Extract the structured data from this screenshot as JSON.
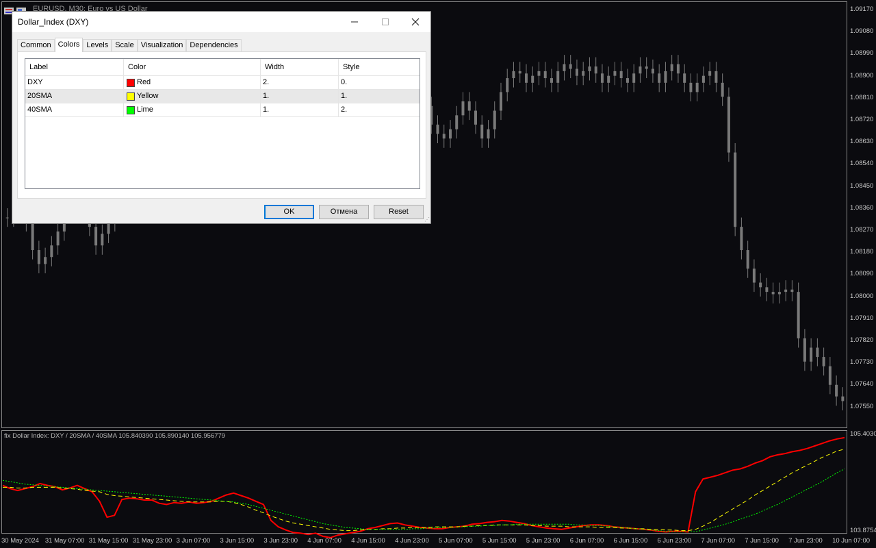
{
  "chart": {
    "title": "EURUSD, M30:  Euro vs US Dollar",
    "indicator_label": "fix Dollar Index: DXY / 20SMA / 40SMA 105.840390 105.890140 105.956779",
    "price_labels": [
      "1.09170",
      "1.09080",
      "1.08990",
      "1.08900",
      "1.08810",
      "1.08720",
      "1.08630",
      "1.08540",
      "1.08450",
      "1.08360",
      "1.08270",
      "1.08180",
      "1.08090",
      "1.08000",
      "1.07910",
      "1.07820",
      "1.07730",
      "1.07640",
      "1.07550"
    ],
    "sub_price_labels": [
      "105.4030",
      "103.8754"
    ],
    "time_labels": [
      "30 May 2024",
      "31 May 07:00",
      "31 May 15:00",
      "31 May 23:00",
      "3 Jun 07:00",
      "3 Jun 15:00",
      "3 Jun 23:00",
      "4 Jun 07:00",
      "4 Jun 15:00",
      "4 Jun 23:00",
      "5 Jun 07:00",
      "5 Jun 15:00",
      "5 Jun 23:00",
      "6 Jun 07:00",
      "6 Jun 15:00",
      "6 Jun 23:00",
      "7 Jun 07:00",
      "7 Jun 15:00",
      "7 Jun 23:00",
      "10 Jun 07:00"
    ],
    "colors": {
      "background": "#0b0b0f",
      "candles": "#7a7a7a",
      "dxy": "#ff0000",
      "sma20": "#ffff00",
      "sma40": "#00ff00"
    }
  },
  "dialog": {
    "title": "Dollar_Index (DXY)",
    "tabs": [
      "Common",
      "Colors",
      "Levels",
      "Scale",
      "Visualization",
      "Dependencies"
    ],
    "active_tab": "Colors",
    "columns": [
      "Label",
      "Color",
      "Width",
      "Style"
    ],
    "rows": [
      {
        "label": "DXY",
        "color_name": "Red",
        "color": "#ff0000",
        "width": "2.",
        "style": "0."
      },
      {
        "label": "20SMA",
        "color_name": "Yellow",
        "color": "#ffff00",
        "width": "1.",
        "style": "1."
      },
      {
        "label": "40SMA",
        "color_name": "Lime",
        "color": "#00ff00",
        "width": "1.",
        "style": "2."
      }
    ],
    "buttons": {
      "ok": "OK",
      "cancel": "Отмена",
      "reset": "Reset"
    },
    "icons": {
      "minimize": "minimize-icon",
      "maximize": "maximize-icon",
      "close": "close-icon"
    }
  },
  "chart_data": {
    "type": "line",
    "main_price_range": [
      1.07505,
      1.09215
    ],
    "indicator_range": [
      103.8754,
      105.403
    ],
    "series": [
      {
        "name": "DXY",
        "values": [
          104.6,
          104.55,
          104.52,
          104.55,
          104.58,
          104.63,
          104.6,
          104.58,
          104.53,
          104.56,
          104.6,
          104.55,
          104.5,
          104.35,
          104.1,
          104.13,
          104.38,
          104.4,
          104.39,
          104.37,
          104.37,
          104.32,
          104.3,
          104.33,
          104.32,
          104.34,
          104.32,
          104.33,
          104.35,
          104.4,
          104.45,
          104.48,
          104.44,
          104.4,
          104.35,
          104.3,
          104.05,
          103.95,
          103.9,
          103.86,
          103.85,
          103.83,
          103.85,
          103.8,
          103.78,
          103.82,
          103.84,
          103.86,
          103.88,
          103.92,
          103.94,
          103.97,
          104.0,
          104.01,
          103.98,
          103.96,
          103.94,
          103.93,
          103.92,
          103.92,
          103.94,
          103.95,
          103.96,
          103.99,
          104.0,
          104.02,
          104.03,
          104.05,
          104.04,
          104.02,
          104.0,
          103.97,
          103.95,
          103.93,
          103.92,
          103.91,
          103.93,
          103.95,
          103.97,
          103.98,
          103.98,
          103.97,
          103.95,
          103.94,
          103.93,
          103.92,
          103.91,
          103.9,
          103.88,
          103.87,
          103.88,
          103.88,
          103.87,
          104.5,
          104.7,
          104.73,
          104.76,
          104.8,
          104.84,
          104.86,
          104.9,
          104.95,
          104.99,
          105.05,
          105.08,
          105.1,
          105.13,
          105.15,
          105.18,
          105.22,
          105.26,
          105.3,
          105.33,
          105.35
        ]
      },
      {
        "name": "20SMA",
        "values": [
          104.57,
          104.57,
          104.56,
          104.56,
          104.57,
          104.57,
          104.57,
          104.57,
          104.56,
          104.55,
          104.54,
          104.52,
          104.51,
          104.5,
          104.46,
          104.44,
          104.43,
          104.42,
          104.41,
          104.4,
          104.39,
          104.38,
          104.37,
          104.36,
          104.35,
          104.34,
          104.34,
          104.34,
          104.34,
          104.35,
          104.35,
          104.33,
          104.3,
          104.26,
          104.21,
          104.17,
          104.12,
          104.08,
          104.04,
          104.01,
          103.99,
          103.97,
          103.95,
          103.93,
          103.91,
          103.9,
          103.89,
          103.89,
          103.9,
          103.91,
          103.91,
          103.92,
          103.92,
          103.93,
          103.93,
          103.94,
          103.94,
          103.94,
          103.95,
          103.95,
          103.95,
          103.95,
          103.96,
          103.96,
          103.97,
          103.97,
          103.98,
          103.98,
          103.98,
          103.98,
          103.98,
          103.97,
          103.97,
          103.96,
          103.96,
          103.96,
          103.95,
          103.95,
          103.95,
          103.95,
          103.94,
          103.94,
          103.94,
          103.93,
          103.93,
          103.92,
          103.92,
          103.91,
          103.91,
          103.9,
          103.9,
          103.89,
          103.89,
          103.91,
          103.96,
          104.02,
          104.09,
          104.16,
          104.23,
          104.3,
          104.37,
          104.45,
          104.52,
          104.59,
          104.66,
          104.73,
          104.8,
          104.86,
          104.92,
          104.98,
          105.04,
          105.09,
          105.14,
          105.17
        ]
      },
      {
        "name": "40SMA",
        "values": [
          104.68,
          104.66,
          104.64,
          104.62,
          104.61,
          104.6,
          104.59,
          104.58,
          104.57,
          104.56,
          104.55,
          104.54,
          104.53,
          104.52,
          104.51,
          104.5,
          104.49,
          104.48,
          104.47,
          104.46,
          104.45,
          104.44,
          104.43,
          104.42,
          104.41,
          104.4,
          104.39,
          104.38,
          104.37,
          104.36,
          104.35,
          104.34,
          104.32,
          104.3,
          104.27,
          104.24,
          104.21,
          104.18,
          104.15,
          104.12,
          104.09,
          104.06,
          104.03,
          104.0,
          103.98,
          103.96,
          103.94,
          103.93,
          103.92,
          103.91,
          103.91,
          103.91,
          103.91,
          103.91,
          103.91,
          103.92,
          103.92,
          103.93,
          103.93,
          103.94,
          103.94,
          103.95,
          103.95,
          103.96,
          103.96,
          103.97,
          103.97,
          103.98,
          103.98,
          103.99,
          103.99,
          103.99,
          103.99,
          103.99,
          103.99,
          103.99,
          103.99,
          103.98,
          103.98,
          103.97,
          103.97,
          103.96,
          103.95,
          103.94,
          103.93,
          103.92,
          103.91,
          103.9,
          103.89,
          103.88,
          103.87,
          103.87,
          103.87,
          103.87,
          103.9,
          103.93,
          103.96,
          103.99,
          104.03,
          104.07,
          104.11,
          104.15,
          104.2,
          104.25,
          104.3,
          104.36,
          104.42,
          104.48,
          104.54,
          104.6,
          104.66,
          104.73,
          104.8,
          104.86
        ]
      }
    ],
    "candles_close": [
      1.0832,
      1.0838,
      1.0835,
      1.083,
      1.0818,
      1.0812,
      1.0815,
      1.082,
      1.0826,
      1.0844,
      1.0852,
      1.0845,
      1.0835,
      1.0828,
      1.082,
      1.0825,
      1.083,
      1.0836,
      1.0842,
      1.085,
      1.0856,
      1.0864,
      1.087,
      1.0873,
      1.0868,
      1.0862,
      1.0858,
      1.086,
      1.0864,
      1.0868,
      1.0872,
      1.0876,
      1.088,
      1.0876,
      1.0874,
      1.087,
      1.0866,
      1.087,
      1.0876,
      1.088,
      1.0885,
      1.0888,
      1.0884,
      1.088,
      1.0876,
      1.0878,
      1.0882,
      1.088,
      1.0876,
      1.0872,
      1.0868,
      1.0866,
      1.0872,
      1.0878,
      1.0882,
      1.0886,
      1.088,
      1.0874,
      1.087,
      1.0864,
      1.0866,
      1.0872,
      1.0878,
      1.0885,
      1.0894,
      1.0888,
      1.088,
      1.0872,
      1.0868,
      1.0866,
      1.087,
      1.0876,
      1.0882,
      1.0878,
      1.0872,
      1.0866,
      1.087,
      1.0878,
      1.0886,
      1.0892,
      1.0895,
      1.0894,
      1.089,
      1.0893,
      1.0895,
      1.0892,
      1.089,
      1.0895,
      1.0898,
      1.0896,
      1.0893,
      1.0895,
      1.0897,
      1.0894,
      1.089,
      1.0893,
      1.0895,
      1.0892,
      1.089,
      1.0894,
      1.0897,
      1.0896,
      1.0894,
      1.089,
      1.0895,
      1.0898,
      1.0894,
      1.089,
      1.0886,
      1.089,
      1.0893,
      1.0895,
      1.089,
      1.0884,
      1.086,
      1.0828,
      1.0818,
      1.081,
      1.0804,
      1.0802,
      1.08,
      1.0799,
      1.08,
      1.0801,
      1.08,
      1.078,
      1.077,
      1.0776,
      1.0772,
      1.0768,
      1.076,
      1.0755,
      1.0753
    ]
  }
}
